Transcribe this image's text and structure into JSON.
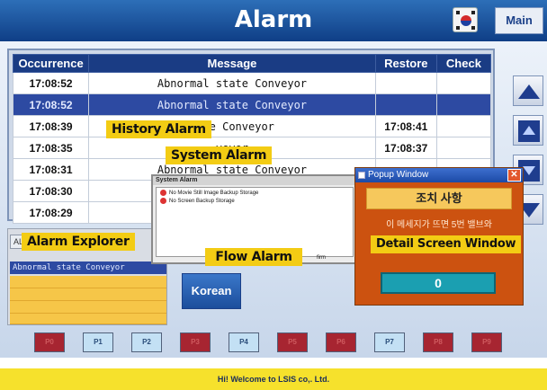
{
  "header": {
    "title": "Alarm",
    "main_label": "Main",
    "flag_icon": "korea-flag-icon"
  },
  "alarm_table": {
    "columns": [
      "Occurrence",
      "Message",
      "Restore",
      "Check"
    ],
    "rows": [
      {
        "occurrence": "17:08:52",
        "message": "Abnormal state Conveyor",
        "restore": "",
        "check": ""
      },
      {
        "occurrence": "17:08:52",
        "message": "Abnormal state Conveyor",
        "restore": "",
        "check": "",
        "selected": true
      },
      {
        "occurrence": "17:08:39",
        "message": "tate Conveyor",
        "restore": "17:08:41",
        "check": ""
      },
      {
        "occurrence": "17:08:35",
        "message": "veyor",
        "restore": "17:08:37",
        "check": ""
      },
      {
        "occurrence": "17:08:31",
        "message": "Abnormal state Conveyor",
        "restore": "",
        "check": ""
      },
      {
        "occurrence": "17:08:30",
        "message": "",
        "restore": "",
        "check": ""
      },
      {
        "occurrence": "17:08:29",
        "message": "",
        "restore": "",
        "check": ""
      }
    ]
  },
  "explorer": {
    "tab_label": "AL",
    "row_text": "Abnormal state Conveyor"
  },
  "korean_button": "Korean",
  "system_window": {
    "title": "System Alarm",
    "items": [
      "No Movie Still Image Backup Storage",
      "No Screen Backup Storage"
    ],
    "confirm_label": "firm"
  },
  "popup": {
    "title": "Popup Window",
    "heading": "조치 사항",
    "body": "이 메세지가 뜨면 5번 밸브와",
    "value": "0"
  },
  "callouts": {
    "history": "History Alarm",
    "system": "System Alarm",
    "explorer": "Alarm Explorer",
    "flow": "Flow Alarm",
    "detail": "Detail Screen Window"
  },
  "page_buttons": [
    {
      "label": "P0",
      "state": "red"
    },
    {
      "label": "P1",
      "state": "blue"
    },
    {
      "label": "P2",
      "state": "blue"
    },
    {
      "label": "P3",
      "state": "red"
    },
    {
      "label": "P4",
      "state": "blue"
    },
    {
      "label": "P5",
      "state": "red"
    },
    {
      "label": "P6",
      "state": "red"
    },
    {
      "label": "P7",
      "state": "blue"
    },
    {
      "label": "P8",
      "state": "red"
    },
    {
      "label": "P9",
      "state": "red"
    }
  ],
  "footer": "Hi! Welcome to LSIS co,. Ltd.",
  "colors": {
    "header_blue": "#1a4c9a",
    "selected_row": "#2d4aa2",
    "callout_yellow": "#f3cc14",
    "popup_orange": "#cc5210"
  }
}
